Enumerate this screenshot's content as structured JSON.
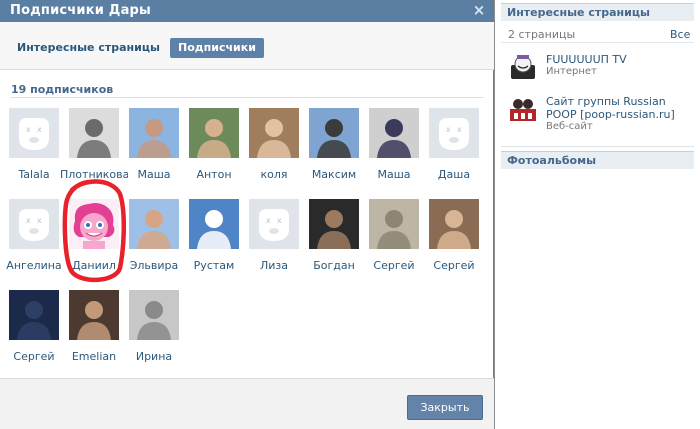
{
  "modal": {
    "title": "Подписчики Дары",
    "close_icon": "×",
    "tabs": [
      {
        "label": "Интересные страницы",
        "active": false
      },
      {
        "label": "Подписчики",
        "active": true
      }
    ],
    "followers_count": "19 подписчиков",
    "close_button": "Закрыть"
  },
  "followers": [
    {
      "name": "Talala",
      "photo": "placeholder"
    },
    {
      "name": "Плотникова",
      "photo": "photo"
    },
    {
      "name": "Маша",
      "photo": "photo"
    },
    {
      "name": "Антон",
      "photo": "photo"
    },
    {
      "name": "коля",
      "photo": "photo"
    },
    {
      "name": "Максим",
      "photo": "photo"
    },
    {
      "name": "Маша",
      "photo": "photo"
    },
    {
      "name": "Даша",
      "photo": "placeholder"
    },
    {
      "name": "Ангелина",
      "photo": "placeholder"
    },
    {
      "name": "Даниил",
      "photo": "pony"
    },
    {
      "name": "Эльвира",
      "photo": "photo"
    },
    {
      "name": "Рустам",
      "photo": "photo"
    },
    {
      "name": "Лиза",
      "photo": "placeholder"
    },
    {
      "name": "Богдан",
      "photo": "photo"
    },
    {
      "name": "Сергей",
      "photo": "photo"
    },
    {
      "name": "Сергей",
      "photo": "photo"
    },
    {
      "name": "Сергей",
      "photo": "photo"
    },
    {
      "name": "Emelian",
      "photo": "photo"
    },
    {
      "name": "Ирина",
      "photo": "photo"
    }
  ],
  "photo_palettes": [
    [
      "#d8d8d8",
      "#a9a9a9"
    ],
    [
      "#dcdcdc",
      "#6b6b6b"
    ],
    [
      "#8cb4e0",
      "#c49a82"
    ],
    [
      "#6d8a5a",
      "#d7b08e"
    ],
    [
      "#a07d5c",
      "#e3c2a3"
    ],
    [
      "#7fa4d1",
      "#3b3b3b"
    ],
    [
      "#cfcfcf",
      "#3a3a5a"
    ],
    [
      "#e9e9e9",
      "#b5b5b5"
    ],
    [
      "#ededed",
      "#b7b7b7"
    ],
    [
      "#f4f4f4",
      "#f25ba6"
    ],
    [
      "#9fc0e6",
      "#d6a585"
    ],
    [
      "#4f84c6",
      "#ffffff"
    ],
    [
      "#ececec",
      "#b7b7b7"
    ],
    [
      "#2a2a2a",
      "#9b7a5f"
    ],
    [
      "#bdb6a4",
      "#8d8676"
    ],
    [
      "#8a6c55",
      "#d9b595"
    ],
    [
      "#1b2a4a",
      "#2e3f66"
    ],
    [
      "#4c3a30",
      "#c29a7a"
    ],
    [
      "#c7c7c7",
      "#8a8a8a"
    ]
  ],
  "right_panel": {
    "interesting": {
      "title": "Интересные страницы",
      "count": "2 страницы",
      "all_link": "Все",
      "items": [
        {
          "title": "FUUUUUUП TV",
          "subtitle": "Интернет"
        },
        {
          "title": "Сайт группы Russian POOP [poop-russian.ru]",
          "subtitle": "Веб-сайт"
        }
      ]
    },
    "albums": {
      "title": "Фотоальбомы"
    }
  },
  "colors": {
    "header": "#5b7ea3",
    "link": "#2b587a",
    "button": "#6383a8",
    "annotation": "#e8212a"
  }
}
